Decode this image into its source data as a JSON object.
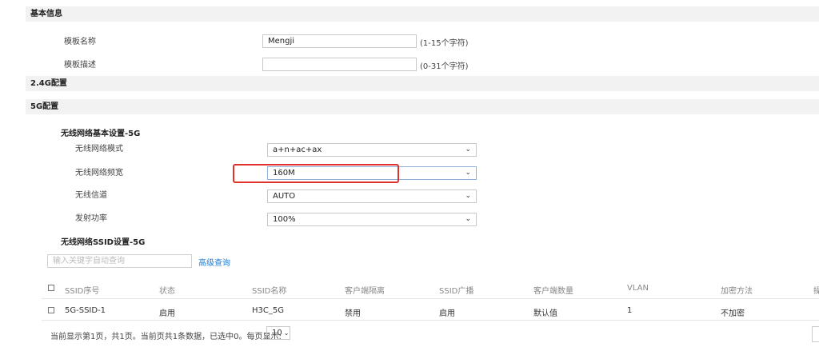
{
  "basic": {
    "header": "基本信息",
    "template_name_label": "模板名称",
    "template_name_value": "Mengji",
    "template_name_hint": "(1-15个字符)",
    "template_desc_label": "模板描述",
    "template_desc_value": "",
    "template_desc_hint": "(0-31个字符)"
  },
  "band24": {
    "header": "2.4G配置"
  },
  "band5": {
    "header": "5G配置",
    "basic_title": "无线网络基本设置-5G",
    "mode_label": "无线网络模式",
    "mode_value": "a+n+ac+ax",
    "bandwidth_label": "无线网络频宽",
    "bandwidth_value": "160M",
    "channel_label": "无线信道",
    "channel_value": "AUTO",
    "power_label": "发射功率",
    "power_value": "100%",
    "ssid_title": "无线网络SSID设置-5G"
  },
  "search": {
    "placeholder": "输入关键字自动查询",
    "advanced_link": "高级查询"
  },
  "table": {
    "columns": [
      "SSID序号",
      "状态",
      "SSID名称",
      "客户端隔离",
      "SSID广播",
      "客户端数量",
      "VLAN",
      "加密方法",
      "操"
    ],
    "rows": [
      [
        "5G-SSID-1",
        "启用",
        "H3C_5G",
        "禁用",
        "启用",
        "默认值",
        "1",
        "不加密"
      ]
    ]
  },
  "footer": {
    "summary": "当前显示第1页，共1页。当前页共1条数据，已选中0。每页显示:",
    "page_size": "10"
  },
  "colors": {
    "highlight": "#e0312b",
    "link": "#1e7bd6",
    "section_bg": "#f2f2f2"
  }
}
